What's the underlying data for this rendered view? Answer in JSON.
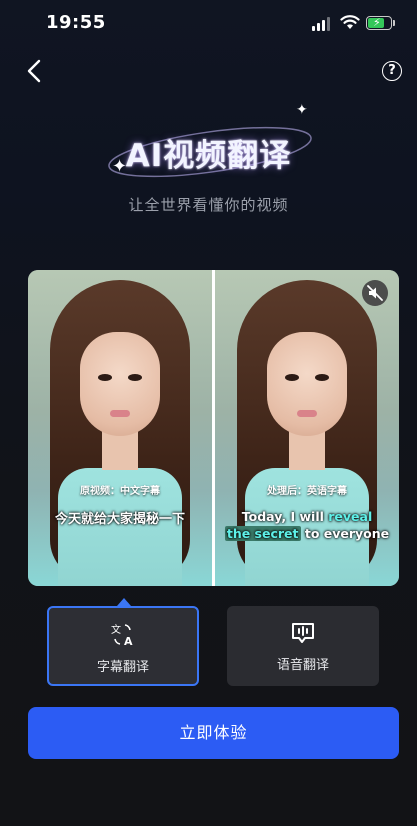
{
  "status_bar": {
    "time": "19:55"
  },
  "nav": {
    "back_icon": "chevron-left-icon",
    "help_label": "?"
  },
  "hero": {
    "title": "AI视频翻译",
    "subtitle": "让全世界看懂你的视频"
  },
  "video_compare": {
    "original_tag": "原视频：中文字幕",
    "original_subtitle": "今天就给大家揭秘一下",
    "processed_tag": "处理后：英语字幕",
    "processed_subtitle_parts": {
      "p1": "Today, I will ",
      "p2": "reveal",
      "p3": "the secret",
      "p4": " to everyone"
    },
    "mute_icon": "speaker-muted-icon"
  },
  "options": [
    {
      "label": "字幕翻译",
      "icon": "translate-icon",
      "selected": true
    },
    {
      "label": "语音翻译",
      "icon": "speech-bubble-icon",
      "selected": false
    }
  ],
  "cta": {
    "label": "立即体验"
  },
  "colors": {
    "accent": "#3b76f5",
    "cta_bg": "#2c5cf4",
    "subtitle_highlight": "#5ef1e9",
    "battery_green": "#34c759"
  }
}
